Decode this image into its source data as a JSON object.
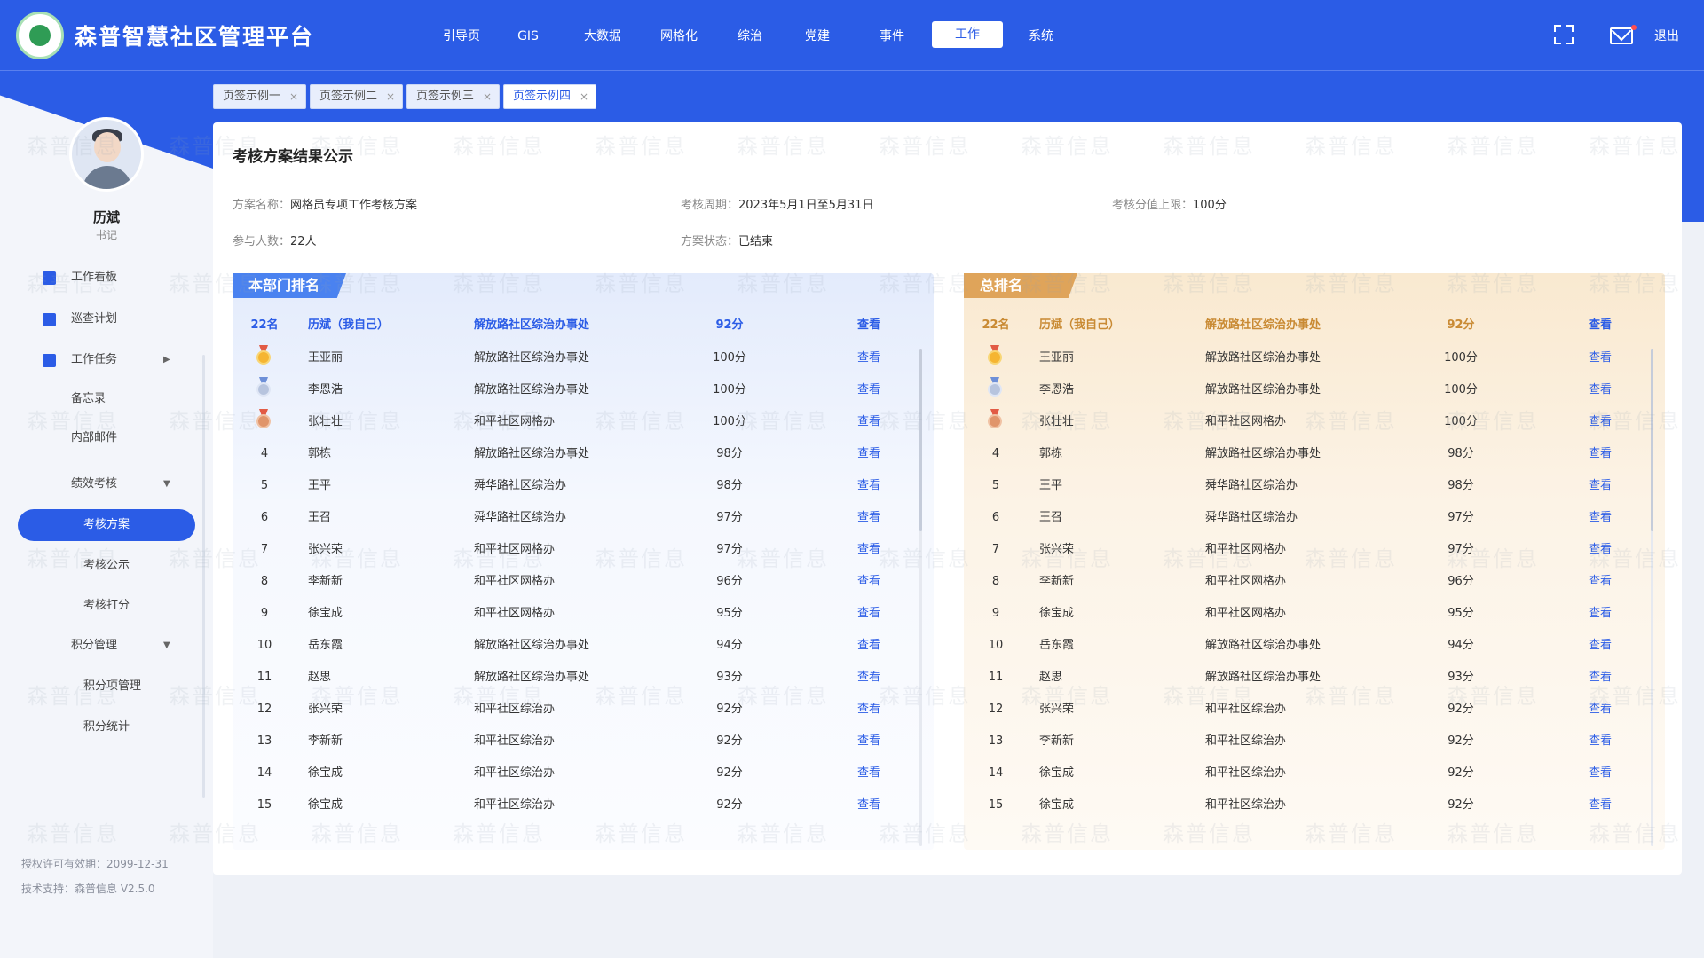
{
  "app": {
    "title": "森普智慧社区管理平台"
  },
  "nav": [
    {
      "label": "引导页"
    },
    {
      "label": "GIS"
    },
    {
      "label": "大数据"
    },
    {
      "label": "网格化"
    },
    {
      "label": "综治"
    },
    {
      "label": "党建"
    },
    {
      "label": "事件"
    },
    {
      "label": "工作"
    },
    {
      "label": "系统"
    }
  ],
  "nav_active": "工作",
  "header": {
    "logout": "退出"
  },
  "tabs": [
    {
      "label": "页签示例一"
    },
    {
      "label": "页签示例二"
    },
    {
      "label": "页签示例三"
    },
    {
      "label": "页签示例四"
    }
  ],
  "tab_close": "×",
  "user": {
    "name": "历斌",
    "role": "书记"
  },
  "menu": [
    {
      "label": "工作看板",
      "icon": "dashboard-icon"
    },
    {
      "label": "巡查计划",
      "icon": "calendar-icon"
    },
    {
      "label": "工作任务",
      "icon": "task-icon",
      "arrow": "▶"
    },
    {
      "label": "备忘录"
    },
    {
      "label": "内部邮件"
    },
    {
      "label": "绩效考核",
      "arrow": "▼"
    },
    {
      "label": "考核方案",
      "active": true
    },
    {
      "label": "考核公示"
    },
    {
      "label": "考核打分"
    },
    {
      "label": "积分管理",
      "arrow": "▼"
    },
    {
      "label": "积分项管理"
    },
    {
      "label": "积分统计"
    }
  ],
  "footer": {
    "license": "授权许可有效期：2099-12-31",
    "support": "技术支持：森普信息  V2.5.0"
  },
  "card": {
    "title": "考核方案结果公示",
    "plan_name_label": "方案名称：",
    "plan_name": "网格员专项工作考核方案",
    "period_label": "考核周期：",
    "period": "2023年5月1日至5月31日",
    "limit_label": "考核分值上限：",
    "limit": "100分",
    "count_label": "参与人数：",
    "count": "22人",
    "status_label": "方案状态：",
    "status": "已结束"
  },
  "watermark": "森普信息",
  "panels": {
    "dept": {
      "title": "本部门排名"
    },
    "total": {
      "title": "总排名"
    }
  },
  "view_label": "查看",
  "me_row": {
    "rank": "22名",
    "name": "历斌（我自己）",
    "org": "解放路社区综治办事处",
    "score": "92分"
  },
  "rows": [
    {
      "rank": "",
      "medal": "gold",
      "name": "王亚丽",
      "org": "解放路社区综治办事处",
      "score": "100分"
    },
    {
      "rank": "",
      "medal": "silver",
      "name": "李恩浩",
      "org": "解放路社区综治办事处",
      "score": "100分"
    },
    {
      "rank": "",
      "medal": "bronze",
      "name": "张壮壮",
      "org": "和平社区网格办",
      "score": "100分"
    },
    {
      "rank": "4",
      "name": "郭栋",
      "org": "解放路社区综治办事处",
      "score": "98分"
    },
    {
      "rank": "5",
      "name": "王平",
      "org": "舜华路社区综治办",
      "score": "98分"
    },
    {
      "rank": "6",
      "name": "王召",
      "org": "舜华路社区综治办",
      "score": "97分"
    },
    {
      "rank": "7",
      "name": "张兴荣",
      "org": "和平社区网格办",
      "score": "97分"
    },
    {
      "rank": "8",
      "name": "李新新",
      "org": "和平社区网格办",
      "score": "96分"
    },
    {
      "rank": "9",
      "name": "徐宝成",
      "org": "和平社区网格办",
      "score": "95分"
    },
    {
      "rank": "10",
      "name": "岳东霞",
      "org": "解放路社区综治办事处",
      "score": "94分"
    },
    {
      "rank": "11",
      "name": "赵思",
      "org": "解放路社区综治办事处",
      "score": "93分"
    },
    {
      "rank": "12",
      "name": "张兴荣",
      "org": "和平社区综治办",
      "score": "92分"
    },
    {
      "rank": "13",
      "name": "李新新",
      "org": "和平社区综治办",
      "score": "92分"
    },
    {
      "rank": "14",
      "name": "徐宝成",
      "org": "和平社区综治办",
      "score": "92分"
    },
    {
      "rank": "15",
      "name": "徐宝成",
      "org": "和平社区综治办",
      "score": "92分"
    }
  ],
  "colors": {
    "primary": "#2b5ce6",
    "gold": "#dfa45a",
    "dept_badge": "#4a82f0"
  }
}
